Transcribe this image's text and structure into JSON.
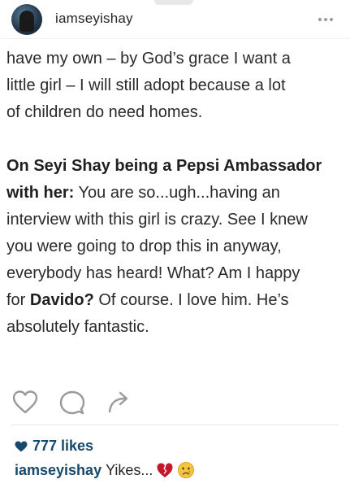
{
  "header": {
    "username": "iamseyishay",
    "more_icon": "more-horizontal-icon"
  },
  "post": {
    "line1": "have my own – by God’s grace I want a",
    "line2": "little girl – I will still adopt because a lot",
    "line3": "of children do need homes.",
    "heading_bold": "On Seyi Shay being a Pepsi Ambassador",
    "heading_bold_2": "with her:",
    "para2_line1_rest": " You are so...ugh...having an",
    "para2_line2": "interview with this girl is crazy. See I knew",
    "para2_line3": "you were going to drop this in anyway,",
    "para2_line4": "everybody has heard! What? Am I happy",
    "para2_line5_a": "for ",
    "para2_line5_bold": "Davido?",
    "para2_line5_b": " Of course. I love him. He’s",
    "para2_line6": "absolutely fantastic."
  },
  "actions": {
    "like_icon": "heart-outline-icon",
    "comment_icon": "comment-bubble-icon",
    "share_icon": "share-arrow-icon"
  },
  "likes": {
    "text": "777 likes",
    "icon": "heart-filled-icon"
  },
  "caption": {
    "username": "iamseyishay",
    "text": "Yikes...",
    "emojis": [
      "broken-heart-emoji",
      "crying-face-emoji"
    ]
  },
  "colors": {
    "link_blue": "#16496b",
    "text": "#2a2a2a",
    "icon_gray": "#9a9a9a",
    "divider": "#e6e6e6"
  }
}
